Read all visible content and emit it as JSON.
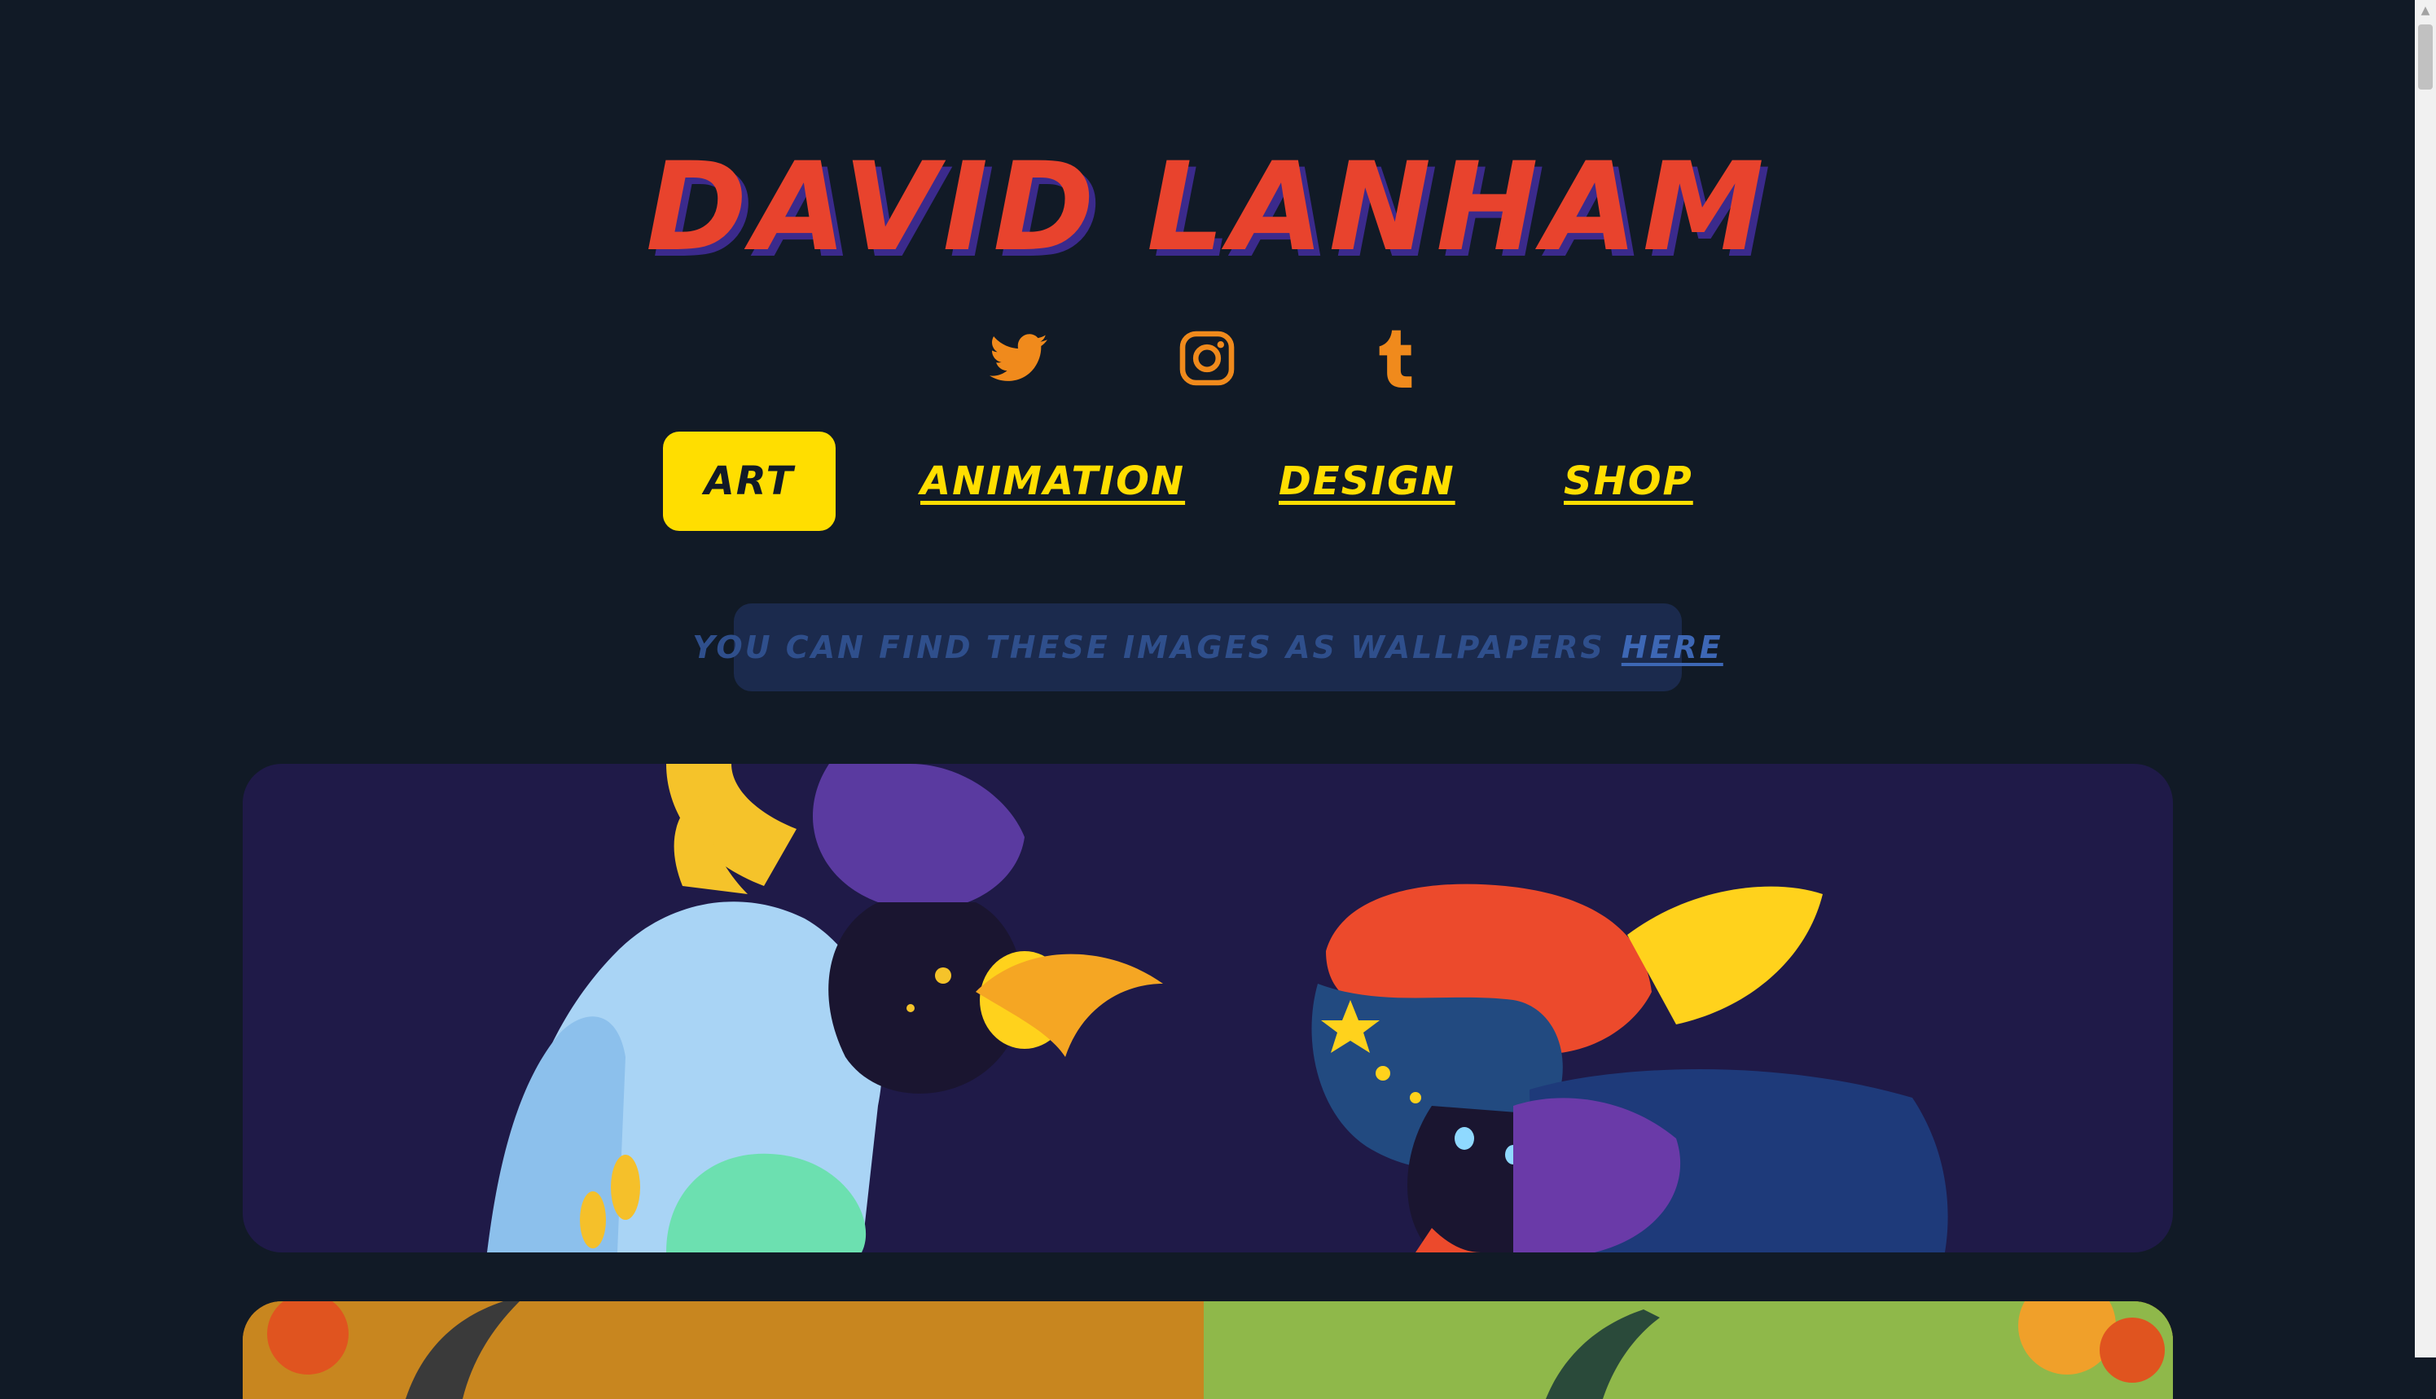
{
  "site": {
    "title": "DAVID LANHAM"
  },
  "socials": [
    {
      "name": "twitter",
      "icon": "twitter-icon"
    },
    {
      "name": "instagram",
      "icon": "instagram-icon"
    },
    {
      "name": "tumblr",
      "icon": "tumblr-icon"
    }
  ],
  "nav": {
    "items": [
      {
        "label": "ART",
        "active": true
      },
      {
        "label": "ANIMATION",
        "active": false
      },
      {
        "label": "DESIGN",
        "active": false
      },
      {
        "label": "SHOP",
        "active": false
      }
    ]
  },
  "notice": {
    "text": "YOU CAN FIND THESE IMAGES AS WALLPAPERS",
    "link_label": "HERE"
  },
  "colors": {
    "background": "#111a26",
    "title": "#e8432d",
    "title_shadow": "#3b2a8c",
    "icon": "#f08a1c",
    "nav": "#ffde00",
    "notice_bg": "#1b2a4d",
    "panel_bg": "#1f1a48"
  }
}
